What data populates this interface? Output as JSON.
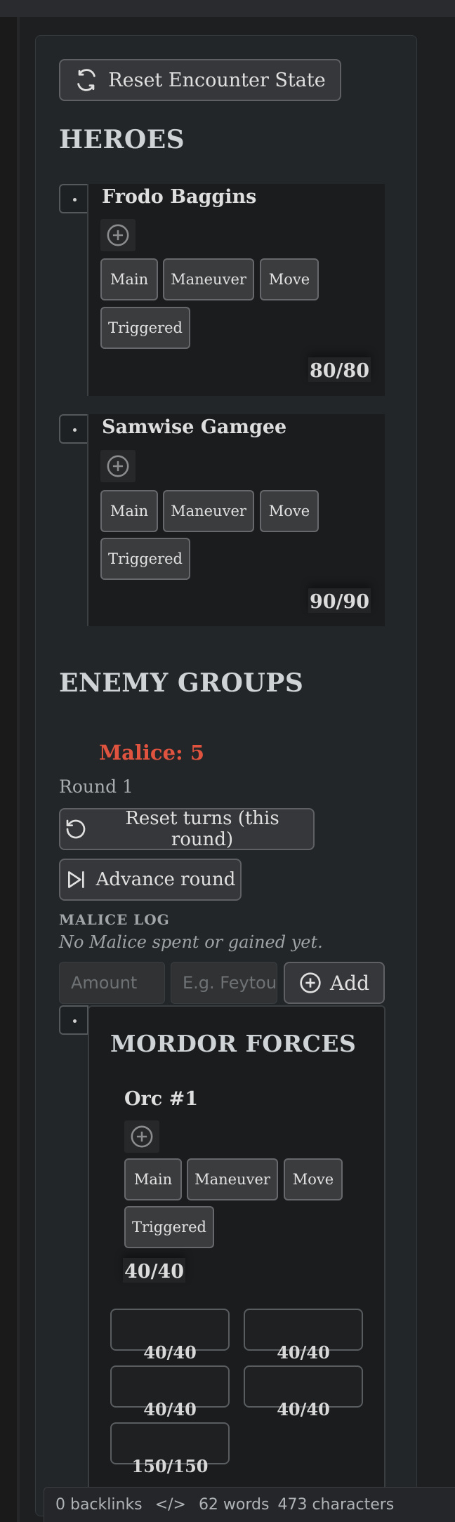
{
  "toolbar": {
    "reset_encounter": "Reset Encounter State"
  },
  "heroes": {
    "heading": "HEROES",
    "items": [
      {
        "name": "Frodo Baggins",
        "stamina": "80/80"
      },
      {
        "name": "Samwise Gamgee",
        "stamina": "90/90"
      }
    ]
  },
  "actions": {
    "main": "Main",
    "maneuver": "Maneuver",
    "move": "Move",
    "triggered": "Triggered"
  },
  "enemies": {
    "heading": "ENEMY GROUPS",
    "malice": "Malice: 5",
    "round": "Round 1",
    "reset_turns": "Reset turns (this round)",
    "advance_round": "Advance round",
    "malice_log_title": "MALICE LOG",
    "malice_log_empty": "No Malice spent or gained yet.",
    "amount_placeholder": "Amount",
    "reason_placeholder": "E.g. Feytouched",
    "add_label": "Add",
    "group": {
      "title": "MORDOR FORCES",
      "creature": {
        "name": "Orc #1",
        "stamina": "40/40"
      },
      "minions": [
        "40/40",
        "40/40",
        "40/40",
        "40/40",
        "150/150"
      ]
    }
  },
  "status": {
    "backlinks": "0 backlinks",
    "code": "</>",
    "words": "62 words",
    "characters": "473 characters"
  },
  "colors": {
    "malice": "#e0533f",
    "panel": "#222629",
    "button": "#36373a"
  }
}
